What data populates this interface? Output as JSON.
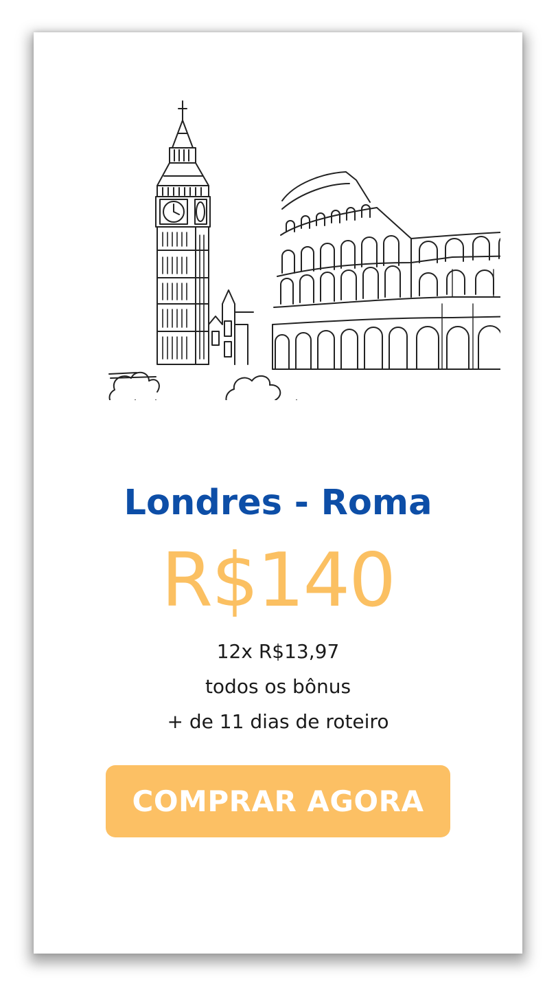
{
  "offer": {
    "title": "Londres - Roma",
    "price": "R$140",
    "installments": "12x R$13,97",
    "bonus_line": "todos os bônus",
    "itinerary_line": "+ de 11 dias de roteiro"
  },
  "cta": {
    "label": "COMPRAR AGORA"
  },
  "illustration": {
    "icons": [
      "big-ben-icon",
      "colosseum-icon"
    ]
  },
  "colors": {
    "title": "#0d4ea7",
    "price": "#fbc062",
    "button": "#fcc064",
    "button_text": "#ffffff",
    "text": "#1a1a1a"
  }
}
